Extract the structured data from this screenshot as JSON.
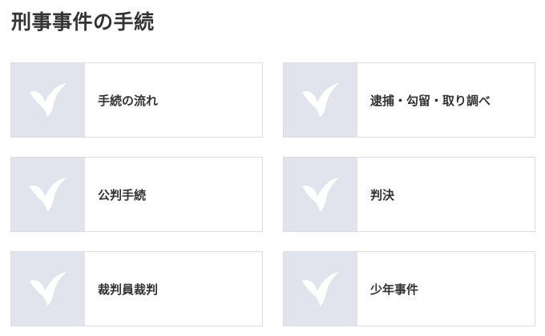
{
  "page": {
    "title": "刑事事件の手続"
  },
  "cards": [
    {
      "label": "手続の流れ",
      "icon": "bird-logo-icon"
    },
    {
      "label": "逮捕・勾留・取り調べ",
      "icon": "bird-logo-icon"
    },
    {
      "label": "公判手続",
      "icon": "bird-logo-icon"
    },
    {
      "label": "判決",
      "icon": "bird-logo-icon"
    },
    {
      "label": "裁判員裁判",
      "icon": "bird-logo-icon"
    },
    {
      "label": "少年事件",
      "icon": "bird-logo-icon"
    }
  ],
  "colors": {
    "thumb_background": "#e2e4ed",
    "icon_fill": "#ffffff",
    "card_border": "#dcdde0",
    "text": "#333333"
  }
}
